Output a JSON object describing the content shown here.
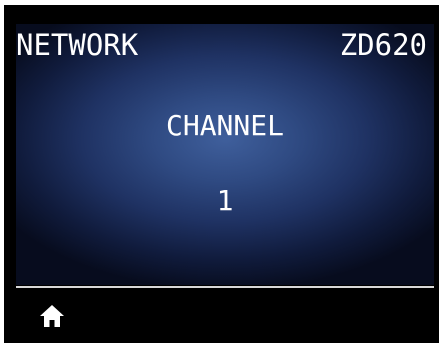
{
  "header": {
    "menu_title": "NETWORK",
    "model_name": "ZD620"
  },
  "setting": {
    "label": "CHANNEL",
    "value": "1"
  },
  "footer": {
    "home_icon": "home-icon"
  },
  "colors": {
    "background": "#000000",
    "text": "#ffffff",
    "panel_center": "#3f5f9c",
    "panel_edge": "#070c1e",
    "divider": "#d8d8d8"
  }
}
